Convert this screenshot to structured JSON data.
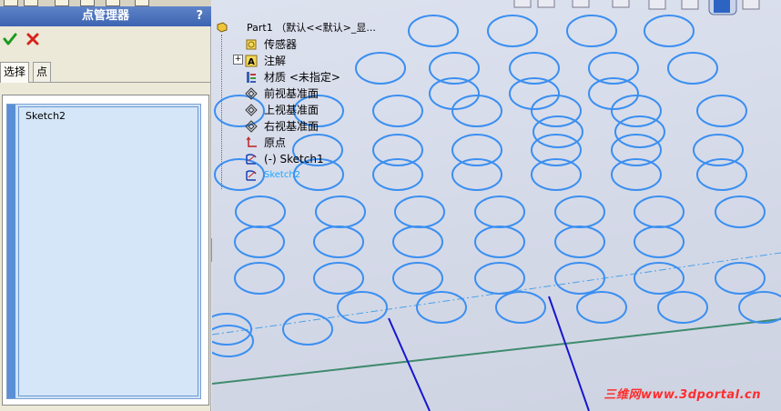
{
  "panel": {
    "title": "点管理器",
    "help": "?",
    "ok_icon": "checkmark-icon",
    "cancel_icon": "x-icon",
    "tabs": [
      "选择",
      "点"
    ],
    "list_items": [
      "Sketch2"
    ]
  },
  "tree": {
    "root": "Part1 （默认<<默认>_显...",
    "items": [
      {
        "label": "传感器",
        "icon": "sensor-icon"
      },
      {
        "label": "注解",
        "icon": "annotation-icon"
      },
      {
        "label": "材质 <未指定>",
        "icon": "material-icon"
      },
      {
        "label": "前视基准面",
        "icon": "plane-icon"
      },
      {
        "label": "上视基准面",
        "icon": "plane-icon"
      },
      {
        "label": "右视基准面",
        "icon": "plane-icon"
      },
      {
        "label": "原点",
        "icon": "origin-icon"
      },
      {
        "label": "(-) Sketch1",
        "icon": "sketch-icon"
      },
      {
        "label": "Sketch2",
        "icon": "sketch-icon",
        "highlighted": true
      }
    ]
  },
  "watermark": "三维网www.3dportal.cn",
  "colors": {
    "title_bar": "#3d64b2",
    "circle_stroke": "#3b8ff0",
    "selected_text": "#1aa7ff",
    "blue_line": "#1616d0",
    "green_line": "#3f8b6e"
  }
}
